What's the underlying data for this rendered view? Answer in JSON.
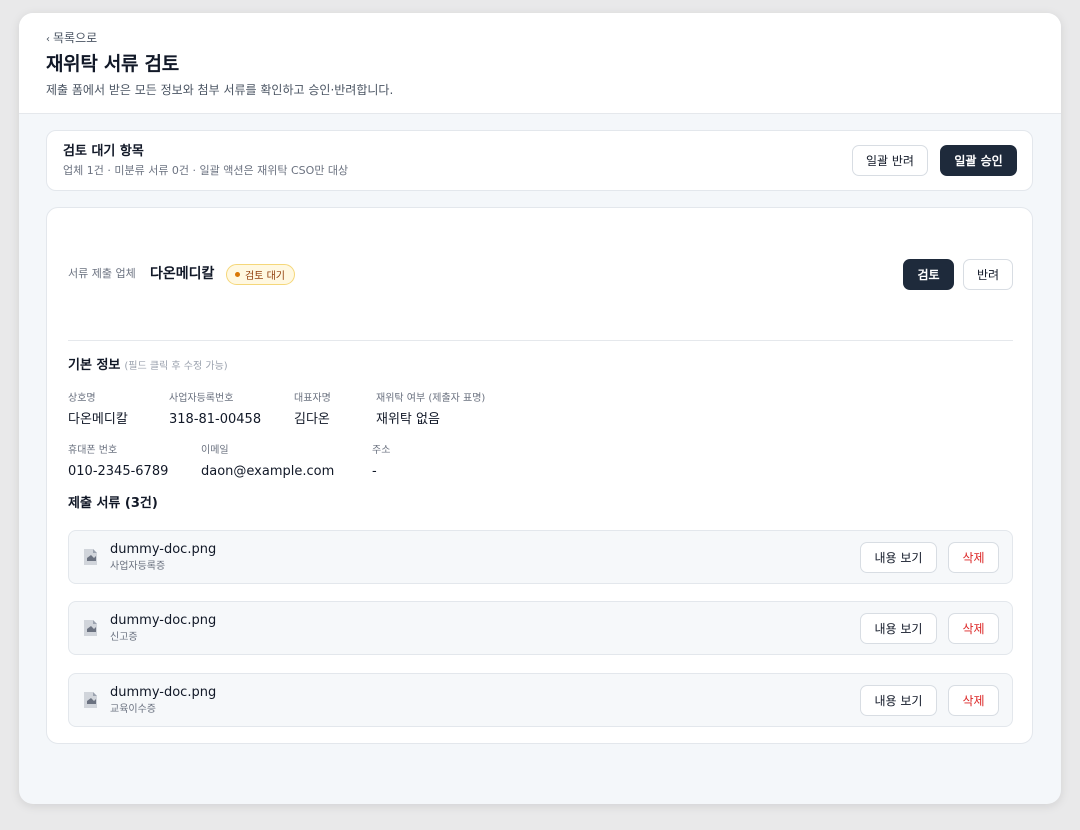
{
  "header": {
    "back_label": "목록으로",
    "title": "재위탁 서류 검토",
    "description": "제출 폼에서 받은 모든 정보와 첨부 서류를 확인하고 승인·반려합니다."
  },
  "queue": {
    "title": "검토 대기 항목",
    "subtitle": "업체 1건 · 미분류 서류 0건 · 일괄 액션은 재위탁 CSO만 대상",
    "bulk_reject_label": "일괄 반려",
    "bulk_approve_label": "일괄 승인"
  },
  "submitter": {
    "label": "서류 제출 업체",
    "name": "다온메디칼",
    "status": "검토 대기",
    "review_label": "검토",
    "reject_label": "반려"
  },
  "basic_info": {
    "title": "기본 정보",
    "hint": "(필드 클릭 후 수정 가능)",
    "fields": [
      {
        "label": "상호명",
        "value": "다온메디칼"
      },
      {
        "label": "사업자등록번호",
        "value": "318-81-00458"
      },
      {
        "label": "대표자명",
        "value": "김다온"
      },
      {
        "label": "재위탁 여부 (제출자 표명)",
        "value": "재위탁 없음"
      },
      {
        "label": "휴대폰 번호",
        "value": "010-2345-6789"
      },
      {
        "label": "이메일",
        "value": "daon@example.com"
      },
      {
        "label": "주소",
        "value": "-"
      }
    ]
  },
  "documents": {
    "title": "제출 서류 (3건)",
    "view_label": "내용 보기",
    "delete_label": "삭제",
    "items": [
      {
        "filename": "dummy-doc.png",
        "type": "사업자등록증"
      },
      {
        "filename": "dummy-doc.png",
        "type": "신고증"
      },
      {
        "filename": "dummy-doc.png",
        "type": "교육이수증"
      }
    ]
  },
  "colors": {
    "primary": "#1e2a3b",
    "danger": "#dc2626",
    "badge_bg": "#fff8e1",
    "badge_text": "#92400e"
  }
}
